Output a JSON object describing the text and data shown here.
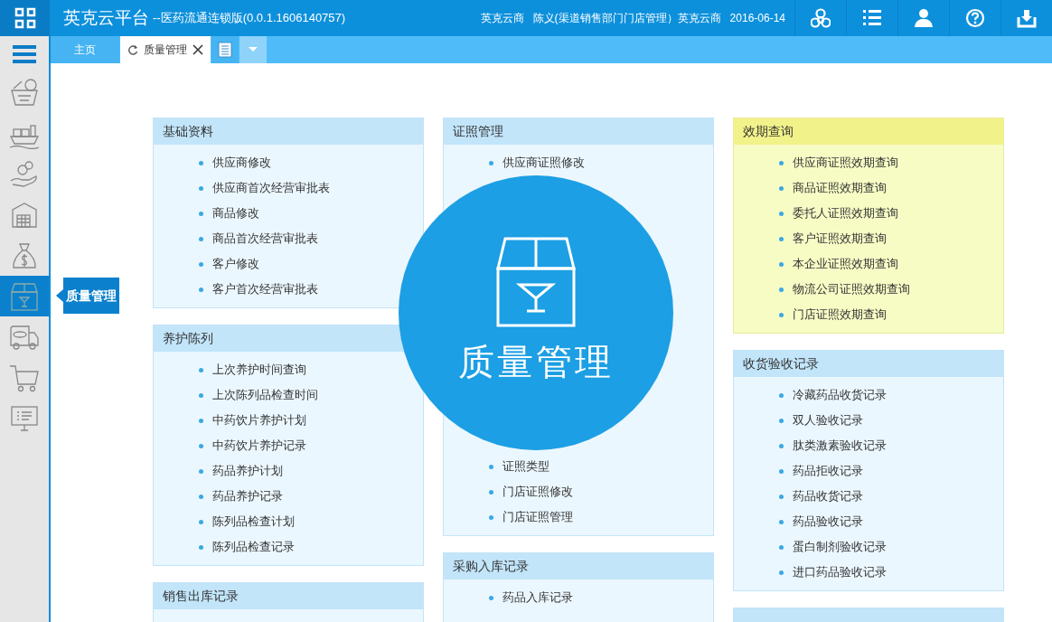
{
  "header": {
    "logo": "英克云平台",
    "subtitle": "--医药流通连锁版(0.0.1.1606140757)",
    "company": "英克云商",
    "user": "陈义(渠道销售部门门店管理）英克云商",
    "date": "2016-06-14"
  },
  "tabs": [
    {
      "label": "主页",
      "selected": false,
      "closable": false
    },
    {
      "label": "质量管理",
      "selected": true,
      "closable": true
    }
  ],
  "sidebar": {
    "items": [
      {
        "kind": "basket",
        "selected": false
      },
      {
        "kind": "ship",
        "selected": false
      },
      {
        "kind": "coins",
        "selected": false
      },
      {
        "kind": "warehouse",
        "selected": false
      },
      {
        "kind": "moneybag",
        "selected": false
      },
      {
        "kind": "box",
        "selected": true
      },
      {
        "kind": "truck",
        "selected": false
      },
      {
        "kind": "cart",
        "selected": false
      },
      {
        "kind": "monitor",
        "selected": false
      }
    ],
    "tooltip": "质量管理"
  },
  "columns": [
    [
      {
        "title": "基础资料",
        "highlight": false,
        "items": [
          "供应商修改",
          "供应商首次经营审批表",
          "商品修改",
          "商品首次经营审批表",
          "客户修改",
          "客户首次经营审批表"
        ]
      },
      {
        "title": "养护陈列",
        "highlight": false,
        "items": [
          "上次养护时间查询",
          "上次陈列品检查时间",
          "中药饮片养护计划",
          "中药饮片养护记录",
          "药品养护计划",
          "药品养护记录",
          "陈列品检查计划",
          "陈列品检查记录"
        ]
      },
      {
        "title": "销售出库记录",
        "highlight": false
      }
    ],
    [
      {
        "title": "证照管理",
        "highlight": false,
        "items": [
          "供应商证照修改"
        ],
        "items_after_overlay": [
          "证照类型",
          "门店证照修改",
          "门店证照管理"
        ]
      },
      {
        "title": "采购入库记录",
        "highlight": false,
        "items": [
          "药品入库记录"
        ]
      }
    ],
    [
      {
        "title": "效期查询",
        "highlight": true,
        "items": [
          "供应商证照效期查询",
          "商品证照效期查询",
          "委托人证照效期查询",
          "客户证照效期查询",
          "本企业证照效期查询",
          "物流公司证照效期查询",
          "门店证照效期查询"
        ]
      },
      {
        "title": "收货验收记录",
        "highlight": false,
        "items": [
          "冷藏药品收货记录",
          "双人验收记录",
          "肽类激素验收记录",
          "药品拒收记录",
          "药品收货记录",
          "药品验收记录",
          "蛋白制剂验收记录",
          "进口药品验收记录"
        ]
      },
      {
        "highlight": false
      }
    ]
  ],
  "overlay": {
    "title": "质量管理"
  }
}
